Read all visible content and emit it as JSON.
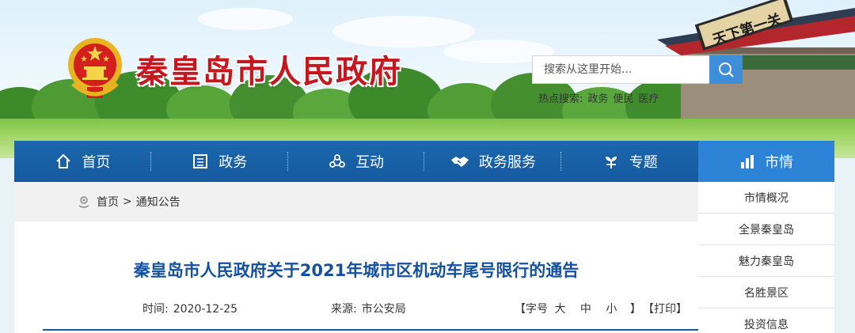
{
  "header": {
    "site_title": "秦皇岛市人民政府",
    "gate_plaque": "天下第一关",
    "search": {
      "placeholder": "搜索从这里开始..."
    },
    "hot": {
      "label": "热点搜索:",
      "terms": [
        "政务",
        "便民",
        "医疗"
      ]
    }
  },
  "nav": {
    "items": [
      {
        "label": "首页",
        "icon": "home-icon"
      },
      {
        "label": "政务",
        "icon": "building-icon"
      },
      {
        "label": "互动",
        "icon": "people-icon"
      },
      {
        "label": "政务服务",
        "icon": "handshake-icon"
      },
      {
        "label": "专题",
        "icon": "sprout-icon"
      },
      {
        "label": "市情",
        "icon": "chart-building-icon",
        "active": true
      }
    ]
  },
  "side_menu": {
    "items": [
      "市情概况",
      "全景秦皇岛",
      "魅力秦皇岛",
      "名胜景区",
      "投资信息"
    ]
  },
  "breadcrumb": {
    "home": "首页",
    "separator": ">",
    "current": "通知公告"
  },
  "article": {
    "title": "秦皇岛市人民政府关于2021年城市区机动车尾号限行的通告",
    "time_label": "时间:",
    "time_value": "2020-12-25",
    "source_label": "来源:",
    "source_value": "市公安局",
    "font_size_label": "【字号",
    "font_large": "大",
    "font_medium": "中",
    "font_small": "小",
    "font_close": "】",
    "print": "【打印】"
  },
  "colors": {
    "title_red": "#c6161e",
    "nav_blue": "#1559a0",
    "nav_active": "#2d84d6",
    "article_title": "#1450a0"
  }
}
